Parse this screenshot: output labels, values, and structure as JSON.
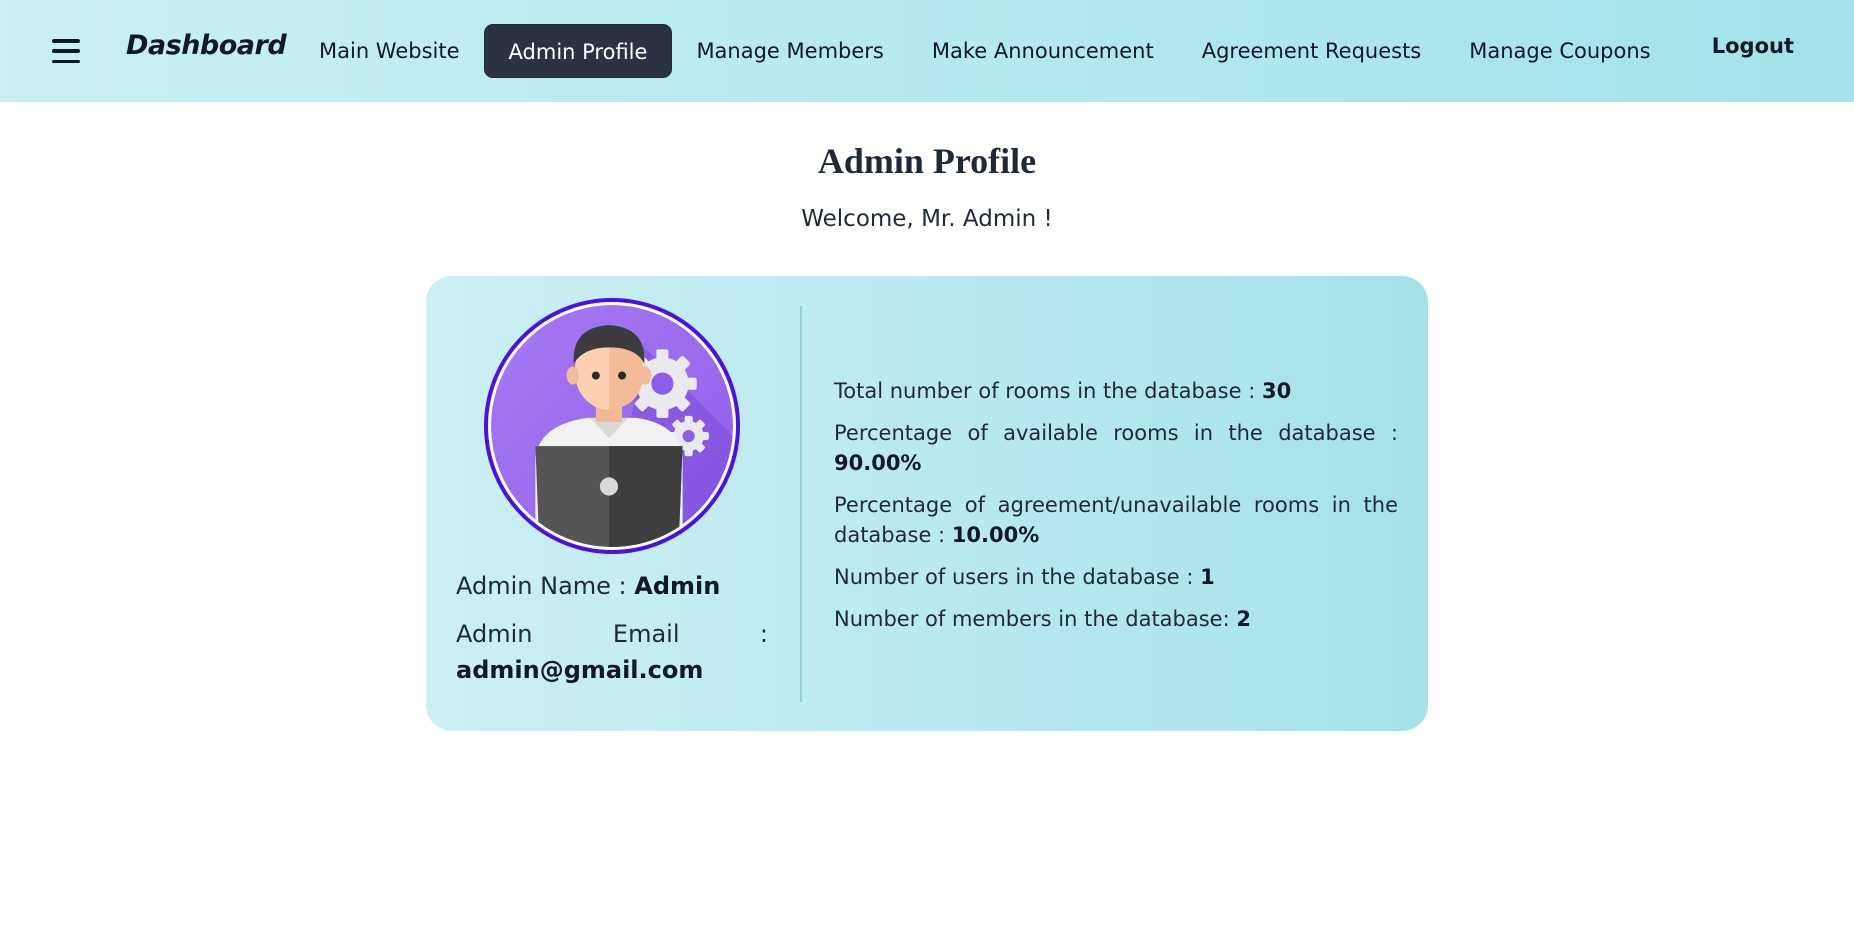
{
  "navbar": {
    "brand": "Dashboard",
    "links": [
      {
        "label": "Main Website",
        "active": false
      },
      {
        "label": "Admin Profile",
        "active": true
      },
      {
        "label": "Manage Members",
        "active": false
      },
      {
        "label": "Make Announcement",
        "active": false
      },
      {
        "label": "Agreement Requests",
        "active": false
      },
      {
        "label": "Manage Coupons",
        "active": false
      }
    ],
    "logout": "Logout"
  },
  "page": {
    "title": "Admin Profile",
    "welcome": "Welcome, Mr. Admin !"
  },
  "profile": {
    "name_label": "Admin Name :",
    "name_value": "Admin",
    "email_label_left": "Admin",
    "email_label_mid": "Email",
    "email_label_colon": ":",
    "email_value": "admin@gmail.com"
  },
  "stats": [
    {
      "label": "Total number of rooms in the database :",
      "value": "30"
    },
    {
      "label": "Percentage of available rooms in the database :",
      "value": "90.00%"
    },
    {
      "label": "Percentage of agreement/unavailable rooms in the database :",
      "value": "10.00%"
    },
    {
      "label": "Number of users in the database :",
      "value": "1"
    },
    {
      "label": "Number of members in the database:",
      "value": "2"
    }
  ],
  "colors": {
    "accent_dark": "#2b3342",
    "avatar_ring": "#4a12e0",
    "card_bg": "#b7e9ef"
  }
}
